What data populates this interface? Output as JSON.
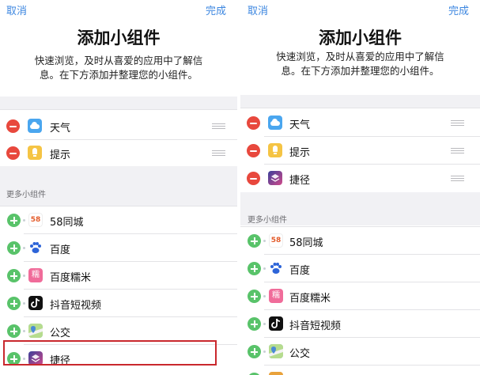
{
  "left": {
    "nav": {
      "cancel": "取消",
      "done": "完成"
    },
    "header": {
      "title": "添加小组件",
      "desc_line1": "快速浏览，及时从喜爱的应用中了解信",
      "desc_line2": "息。在下方添加并整理您的小组件。"
    },
    "widgets": [
      {
        "label": "天气",
        "icon": "weather-icon"
      },
      {
        "label": "提示",
        "icon": "tips-icon"
      }
    ],
    "more_title": "更多小组件",
    "more": [
      {
        "label": "58同城",
        "icon": "58-icon"
      },
      {
        "label": "百度",
        "icon": "baidu-icon"
      },
      {
        "label": "百度糯米",
        "icon": "nuomi-icon"
      },
      {
        "label": "抖音短视频",
        "icon": "douyin-icon"
      },
      {
        "label": "公交",
        "icon": "bus-icon"
      },
      {
        "label": "捷径",
        "icon": "shortcuts-icon"
      }
    ]
  },
  "right": {
    "nav": {
      "cancel": "取消",
      "done": "完成"
    },
    "header": {
      "title": "添加小组件",
      "desc_line1": "快速浏览，及时从喜爱的应用中了解信",
      "desc_line2": "息。在下方添加并整理您的小组件。"
    },
    "widgets": [
      {
        "label": "天气",
        "icon": "weather-icon"
      },
      {
        "label": "提示",
        "icon": "tips-icon"
      },
      {
        "label": "捷径",
        "icon": "shortcuts-icon"
      }
    ],
    "more_title": "更多小组件",
    "more": [
      {
        "label": "58同城",
        "icon": "58-icon"
      },
      {
        "label": "百度",
        "icon": "baidu-icon"
      },
      {
        "label": "百度糯米",
        "icon": "nuomi-icon"
      },
      {
        "label": "抖音短视频",
        "icon": "douyin-icon"
      },
      {
        "label": "公交",
        "icon": "bus-icon"
      }
    ]
  },
  "icon_text": {
    "58": "58",
    "nuomi": "糯"
  },
  "colors": {
    "accent": "#3d87e0",
    "remove": "#e8483d",
    "add": "#59c36a",
    "highlight": "#c9282d"
  }
}
